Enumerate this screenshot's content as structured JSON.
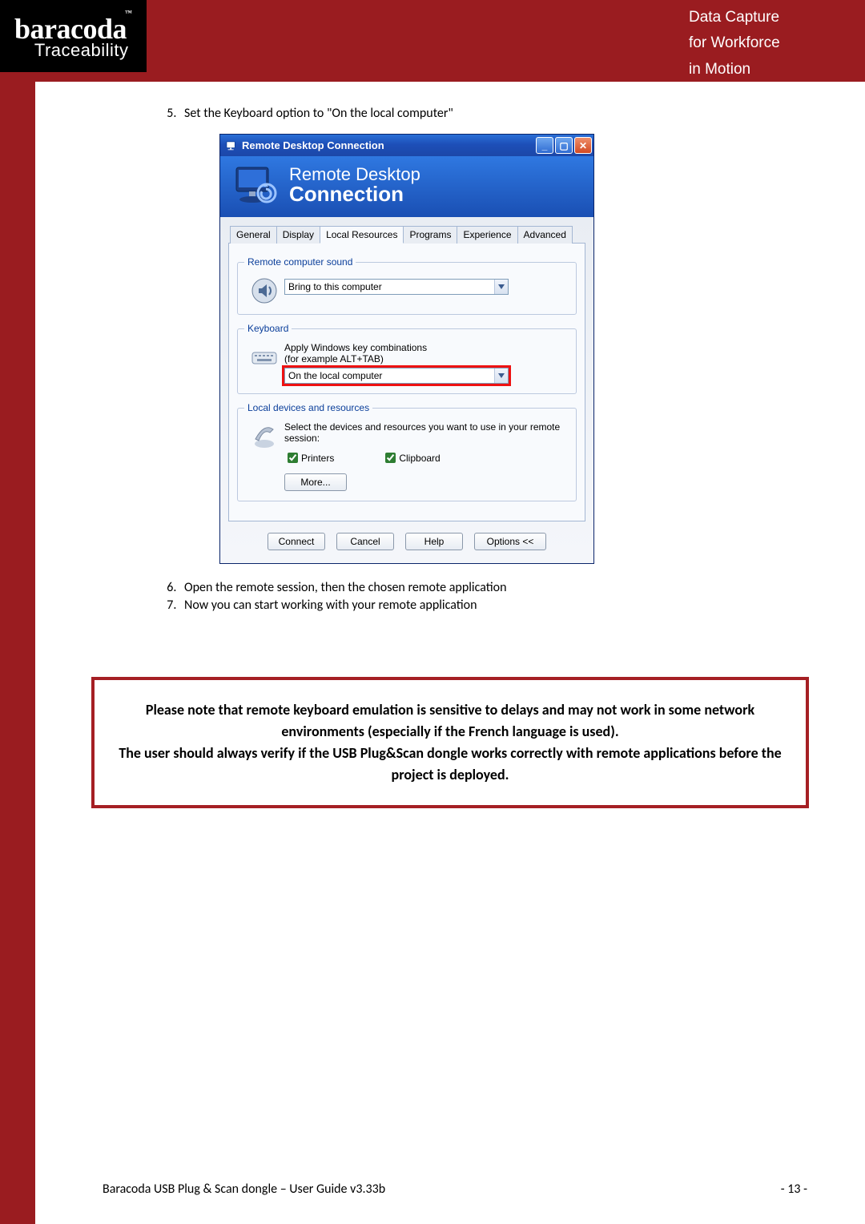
{
  "header": {
    "logo_main": "baracoda",
    "logo_tm": "™",
    "logo_sub": "Traceability",
    "tagline_l1": "Data Capture",
    "tagline_l2": "for Workforce",
    "tagline_l3": "in Motion"
  },
  "steps": {
    "s5": "Set the Keyboard option to \"On the local computer\"",
    "s6": "Open the remote session, then the chosen remote application",
    "s7": "Now you can start working with your remote application"
  },
  "rdc": {
    "title": "Remote Desktop Connection",
    "banner_l1": "Remote Desktop",
    "banner_l2": "Connection",
    "tabs": {
      "general": "General",
      "display": "Display",
      "local": "Local Resources",
      "programs": "Programs",
      "experience": "Experience",
      "advanced": "Advanced"
    },
    "group_sound": {
      "legend": "Remote computer sound",
      "value": "Bring to this computer"
    },
    "group_keyboard": {
      "legend": "Keyboard",
      "label_l1": "Apply Windows key combinations",
      "label_l2": "(for example ALT+TAB)",
      "value": "On the local computer"
    },
    "group_devices": {
      "legend": "Local devices and resources",
      "desc": "Select the devices and resources you want to use in your remote session:",
      "printers": "Printers",
      "clipboard": "Clipboard",
      "more": "More..."
    },
    "buttons": {
      "connect": "Connect",
      "cancel": "Cancel",
      "help": "Help",
      "options": "Options <<"
    }
  },
  "note": {
    "p1": "Please note that remote keyboard emulation is sensitive to delays and may not work in some network environments (especially if the French language is used).",
    "p2": "The user should always verify if the USB Plug&Scan dongle works correctly with remote applications before the project is deployed."
  },
  "footer": {
    "left": "Baracoda USB Plug & Scan dongle – User Guide v3.33b",
    "right": "- 13 -"
  }
}
